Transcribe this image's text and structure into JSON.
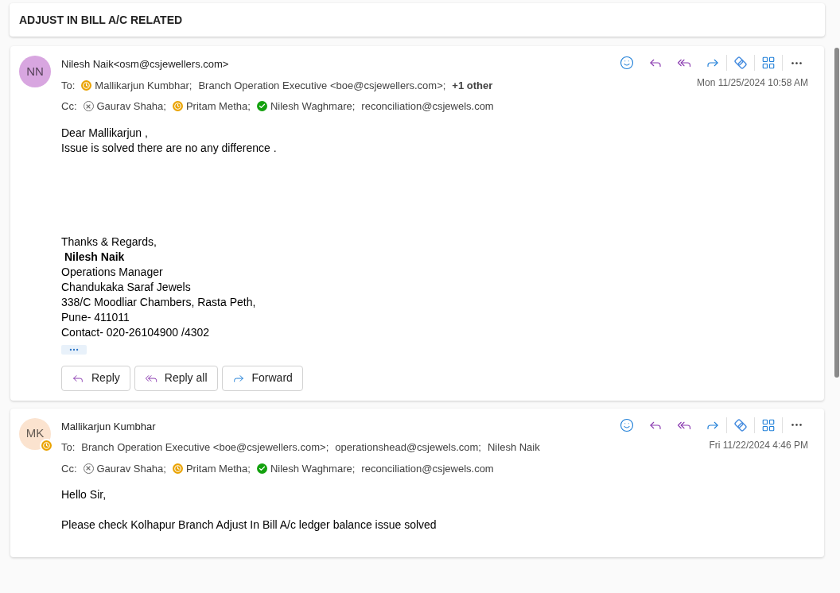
{
  "subject": "ADJUST IN BILL A/C RELATED",
  "messages": [
    {
      "initials": "NN",
      "color": "#d8a6e0",
      "presence_badge": false,
      "sender": "Nilesh Naik<osm@csjewellers.com>",
      "date": "Mon 11/25/2024 10:58 AM",
      "to_label": "To:",
      "to": [
        {
          "name": "Mallikarjun Kumbhar;",
          "kind": "away"
        },
        {
          "name": "Branch Operation Executive <boe@csjewellers.com>;",
          "kind": "plain"
        },
        {
          "name": "+1 other",
          "kind": "more"
        }
      ],
      "cc_label": "Cc:",
      "cc": [
        {
          "name": "Gaurav Shaha;",
          "kind": "offline"
        },
        {
          "name": "Pritam Metha;",
          "kind": "away"
        },
        {
          "name": "Nilesh Waghmare;",
          "kind": "available"
        },
        {
          "name": "reconciliation@csjewels.com",
          "kind": "plain"
        }
      ],
      "body": [
        {
          "kind": "paragraph",
          "lines": [
            {
              "text": "Dear Mallikarjun ,",
              "bold": false
            },
            {
              "text": "Issue is solved there are no any difference .",
              "bold": false
            }
          ]
        },
        {
          "kind": "signature",
          "lines": [
            {
              "text": "Thanks & Regards,",
              "bold": false
            },
            {
              "text": " Nilesh Naik",
              "bold": true
            },
            {
              "text": "Operations Manager",
              "bold": false
            },
            {
              "text": "Chandukaka Saraf Jewels",
              "bold": false
            },
            {
              "text": "338/C Moodliar Chambers, Rasta Peth,",
              "bold": false
            },
            {
              "text": "Pune- 411011",
              "bold": false
            },
            {
              "text": "Contact- 020-26104900 /4302",
              "bold": false
            }
          ]
        }
      ],
      "show_more": true,
      "actions": [
        {
          "label": "Reply",
          "kind": "reply"
        },
        {
          "label": "Reply all",
          "kind": "replyall"
        },
        {
          "label": "Forward",
          "kind": "forward"
        }
      ]
    },
    {
      "initials": "MK",
      "color": "#fbe3cf",
      "presence_badge": true,
      "sender": "Mallikarjun Kumbhar",
      "date": "Fri 11/22/2024 4:46 PM",
      "to_label": "To:",
      "to": [
        {
          "name": "Branch Operation Executive <boe@csjewellers.com>;",
          "kind": "plain"
        },
        {
          "name": "operationshead@csjewels.com;",
          "kind": "plain"
        },
        {
          "name": "Nilesh Naik",
          "kind": "plain"
        }
      ],
      "cc_label": "Cc:",
      "cc": [
        {
          "name": "Gaurav Shaha;",
          "kind": "offline"
        },
        {
          "name": "Pritam Metha;",
          "kind": "away"
        },
        {
          "name": "Nilesh Waghmare;",
          "kind": "available"
        },
        {
          "name": "reconciliation@csjewels.com",
          "kind": "plain"
        }
      ],
      "body": [
        {
          "kind": "paragraph",
          "lines": [
            {
              "text": "Hello Sir,",
              "bold": false
            }
          ]
        },
        {
          "kind": "paragraph",
          "lines": [
            {
              "text": "Please check Kolhapur Branch Adjust In Bill A/c ledger balance issue solved",
              "bold": false
            }
          ]
        }
      ]
    }
  ]
}
